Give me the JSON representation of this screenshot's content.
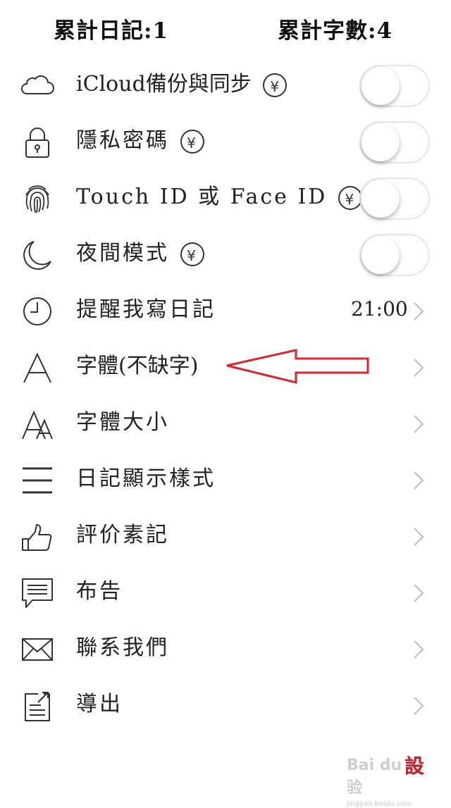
{
  "stats": {
    "diary_total": "累計日記:1",
    "char_total": "累計字數:4"
  },
  "settings": [
    {
      "label": "iCloud備份與同步",
      "icon": "cloud-icon",
      "paid": true,
      "control": "toggle",
      "on": false
    },
    {
      "label": "隱私密碼",
      "icon": "lock-icon",
      "paid": true,
      "control": "toggle",
      "on": false
    },
    {
      "label": "Touch ID 或 Face ID",
      "icon": "fingerprint-icon",
      "paid": true,
      "control": "toggle",
      "on": false
    },
    {
      "label": "夜間模式",
      "icon": "moon-icon",
      "paid": true,
      "control": "toggle",
      "on": false
    },
    {
      "label": "提醒我寫日記",
      "icon": "clock-icon",
      "control": "chevron",
      "value": "21:00"
    },
    {
      "label": "字體(不缺字)",
      "icon": "font-icon",
      "control": "chevron"
    },
    {
      "label": "字體大小",
      "icon": "font-size-icon",
      "control": "chevron"
    },
    {
      "label": "日記顯示樣式",
      "icon": "list-style-icon",
      "control": "chevron"
    },
    {
      "label": "評价素記",
      "icon": "thumbs-up-icon",
      "control": "chevron"
    },
    {
      "label": "布告",
      "icon": "message-icon",
      "control": "chevron"
    },
    {
      "label": "聯系我們",
      "icon": "envelope-icon",
      "control": "chevron"
    },
    {
      "label": "導出",
      "icon": "export-icon",
      "control": "chevron"
    }
  ],
  "paid_badge": "¥",
  "watermark": {
    "text": "Bai du 经验",
    "sub": "jingyan.baidu.com"
  },
  "seal": "設",
  "annotation_color": "#d9252b"
}
